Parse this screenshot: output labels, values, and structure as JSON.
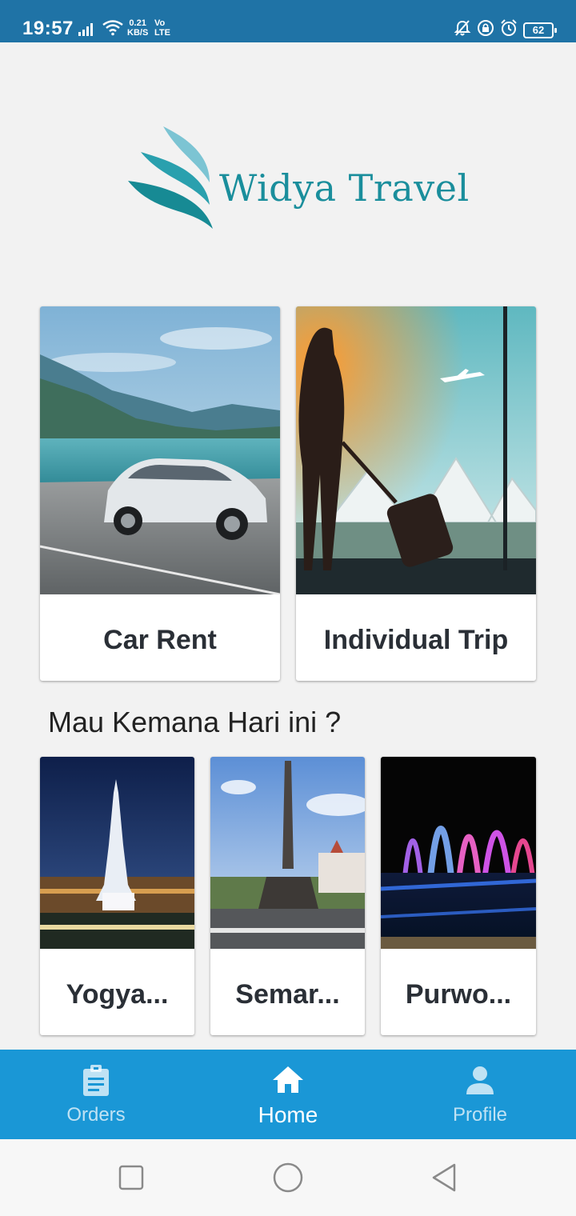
{
  "status_bar": {
    "time": "19:57",
    "speed_value": "0.21",
    "speed_unit": "KB/S",
    "volte_top": "Vo",
    "volte_bottom": "LTE",
    "battery": "62",
    "icons": [
      "signal-icon",
      "wifi-icon",
      "mute-icon",
      "lock-rotation-icon",
      "alarm-icon",
      "battery-icon"
    ]
  },
  "logo": {
    "text": "Widya Travel",
    "colors": [
      "#1a8e9c",
      "#5bb7c8",
      "#0f6f78"
    ]
  },
  "services": [
    {
      "label": "Car Rent",
      "image": "car-on-lakeside-road"
    },
    {
      "label": "Individual Trip",
      "image": "traveler-silhouette-airport"
    }
  ],
  "section_title": "Mau Kemana Hari ini ?",
  "destinations": [
    {
      "label": "Yogya...",
      "image": "tugu-yogyakarta-night"
    },
    {
      "label": "Semar...",
      "image": "tugu-muda-semarang"
    },
    {
      "label": "Purwo...",
      "image": "purwokerto-fountain"
    }
  ],
  "bottom_nav": {
    "background": "#1a97d6",
    "items": [
      {
        "label": "Orders",
        "icon": "clipboard-icon",
        "active": false
      },
      {
        "label": "Home",
        "icon": "home-icon",
        "active": true
      },
      {
        "label": "Profile",
        "icon": "person-icon",
        "active": false
      }
    ]
  },
  "system_nav": {
    "icons": [
      "recents-square-icon",
      "home-circle-icon",
      "back-triangle-icon"
    ]
  }
}
